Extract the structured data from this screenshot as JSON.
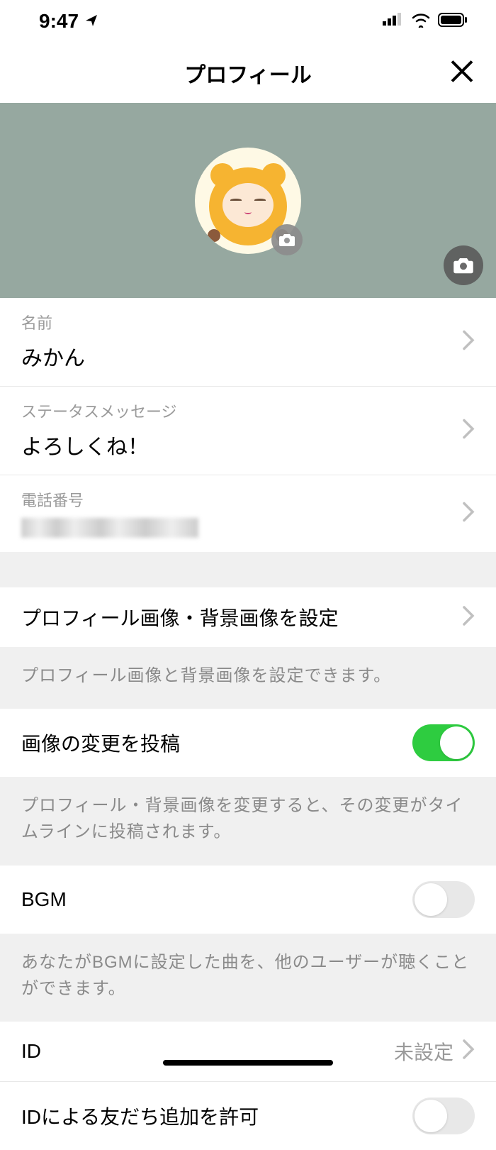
{
  "status": {
    "time": "9:47"
  },
  "header": {
    "title": "プロフィール"
  },
  "profile": {
    "name_label": "名前",
    "name_value": "みかん",
    "status_label": "ステータスメッセージ",
    "status_value": "よろしくね！",
    "phone_label": "電話番号"
  },
  "images_row": {
    "title": "プロフィール画像・背景画像を設定",
    "desc": "プロフィール画像と背景画像を設定できます。"
  },
  "post_change": {
    "title": "画像の変更を投稿",
    "desc": "プロフィール・背景画像を変更すると、その変更がタイムラインに投稿されます。",
    "enabled": true
  },
  "bgm": {
    "title": "BGM",
    "desc": "あなたがBGMに設定した曲を、他のユーザーが聴くことができます。",
    "enabled": false
  },
  "id_row": {
    "title": "ID",
    "value": "未設定"
  },
  "id_friend": {
    "title": "IDによる友だち追加を許可",
    "enabled": false
  }
}
